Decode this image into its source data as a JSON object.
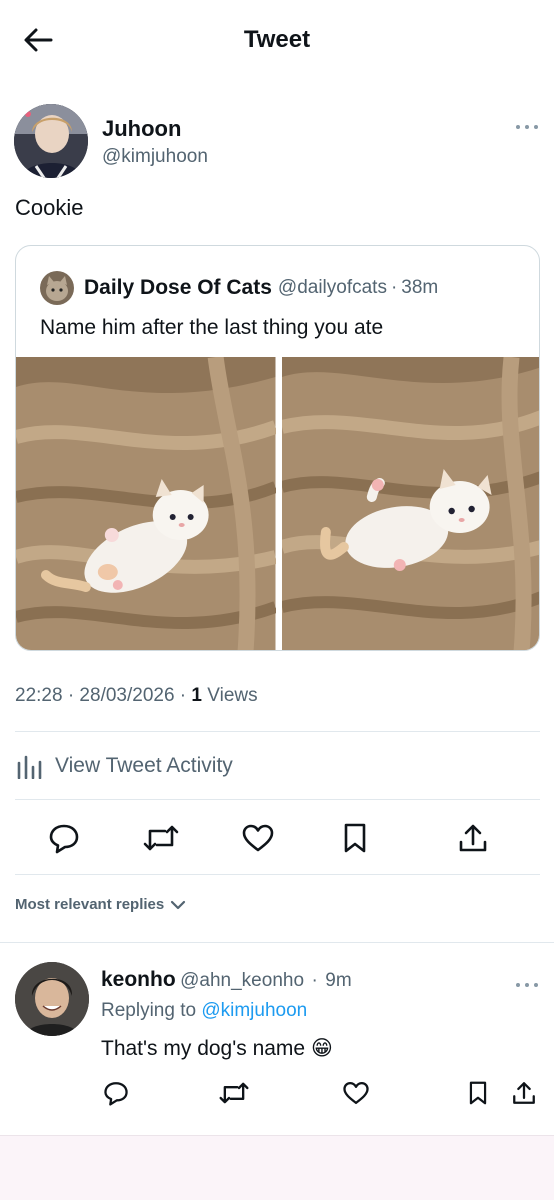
{
  "header": {
    "title": "Tweet",
    "back_icon": "arrow-left-icon"
  },
  "tweet": {
    "author_name": "Juhoon",
    "author_handle": "@kimjuhoon",
    "text": "Cookie",
    "timestamp": "22:28 · 28/03/2026 ·",
    "views_count": "1",
    "views_label": "Views",
    "more_icon": "more-horizontal-icon"
  },
  "quote": {
    "name": "Daily Dose Of Cats",
    "handle": "@dailyofcats",
    "time": "38m",
    "text": "Name him after the last thing you ate",
    "media_count": 2
  },
  "activity": {
    "label": "View Tweet Activity",
    "icon": "analytics-bars-icon"
  },
  "actions": [
    {
      "name": "reply",
      "icon": "reply-bubble-icon"
    },
    {
      "name": "retweet",
      "icon": "retweet-icon"
    },
    {
      "name": "like",
      "icon": "heart-icon"
    },
    {
      "name": "bookmark",
      "icon": "bookmark-icon"
    },
    {
      "name": "share",
      "icon": "share-upload-icon"
    }
  ],
  "replies_sort": {
    "label": "Most relevant replies",
    "icon": "chevron-down-icon"
  },
  "reply": {
    "name": "keonho",
    "handle": "@ahn_keonho",
    "time": "9m",
    "replying_prefix": "Replying to",
    "replying_to": "@kimjuhoon",
    "text": "That's my dog's name 😁"
  },
  "colors": {
    "text": "#0f1419",
    "secondary": "#536471",
    "link": "#1d9bf0",
    "border": "#cfd9de",
    "bottom_area": "#fbf4f9"
  }
}
